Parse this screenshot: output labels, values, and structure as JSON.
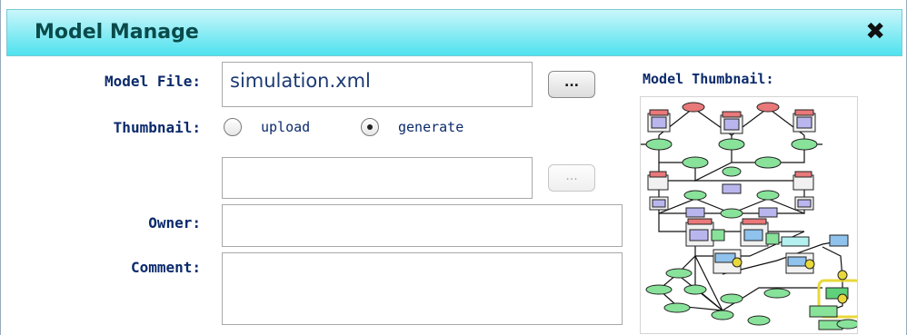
{
  "window": {
    "title": "Model Manage",
    "close_glyph": "✖"
  },
  "form": {
    "model_file_label": "Model File:",
    "model_file_value": "simulation.xml",
    "browse_label": "...",
    "thumbnail_label": "Thumbnail:",
    "upload_label": "upload",
    "generate_label": "generate",
    "thumbnail_selected": "generate",
    "thumbnail_file_value": "",
    "thumb_browse_label": "...",
    "owner_label": "Owner:",
    "owner_value": "",
    "comment_label": "Comment:",
    "comment_value": ""
  },
  "preview": {
    "label": "Model Thumbnail:"
  },
  "colors": {
    "title_bar_top": "#c9f6fb",
    "title_bar_bottom": "#4ee2ee",
    "label_text": "#0b2a6b",
    "thumb_red": "#e8787a",
    "thumb_green": "#88e29a",
    "thumb_purple": "#b9b6ee",
    "thumb_blue": "#8fc2ec",
    "thumb_yellow": "#e8d83a"
  }
}
